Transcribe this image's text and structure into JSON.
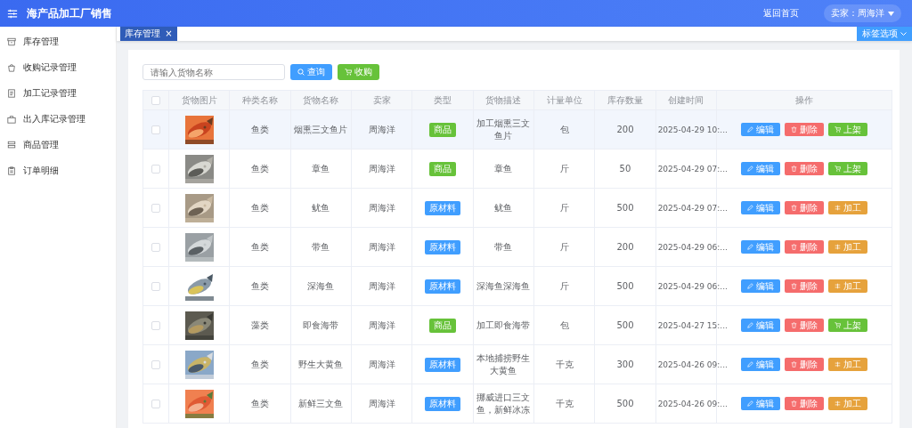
{
  "header": {
    "title": "海产品加工厂销售",
    "home_link": "返回首页",
    "user_menu": "卖家：周海洋"
  },
  "sidebar": {
    "items": [
      {
        "label": "库存管理"
      },
      {
        "label": "收购记录管理"
      },
      {
        "label": "加工记录管理"
      },
      {
        "label": "出入库记录管理"
      },
      {
        "label": "商品管理"
      },
      {
        "label": "订单明细"
      }
    ]
  },
  "tabs": [
    {
      "label": "库存管理",
      "close": "×",
      "selected": true
    }
  ],
  "tab_options": "标签选项",
  "search": {
    "placeholder": "请输入货物名称",
    "query_button": "查询",
    "buy_button": "收购"
  },
  "table": {
    "header_checked": false,
    "columns": [
      "货物图片",
      "种类名称",
      "货物名称",
      "卖家",
      "类型",
      "货物描述",
      "计量单位",
      "库存数量",
      "创建时间",
      "操作"
    ],
    "rows": [
      {
        "checked": false,
        "hovered": true,
        "category": "鱼类",
        "name": "烟熏三文鱼片",
        "seller": "周海洋",
        "type": {
          "label": "商品",
          "kind": "goods"
        },
        "description": "加工烟熏三文鱼片",
        "unit": "包",
        "stock": "200",
        "created": "2025-04-29 10:...",
        "actions": [
          {
            "label": "编辑",
            "kind": "edit"
          },
          {
            "label": "删除",
            "kind": "delete"
          },
          {
            "label": "上架",
            "kind": "shelve"
          }
        ]
      },
      {
        "checked": false,
        "hovered": false,
        "category": "鱼类",
        "name": "章鱼",
        "seller": "周海洋",
        "type": {
          "label": "商品",
          "kind": "goods"
        },
        "description": "章鱼",
        "unit": "斤",
        "stock": "50",
        "created": "2025-04-29 07:...",
        "actions": [
          {
            "label": "编辑",
            "kind": "edit"
          },
          {
            "label": "删除",
            "kind": "delete"
          },
          {
            "label": "上架",
            "kind": "shelve"
          }
        ]
      },
      {
        "checked": false,
        "hovered": false,
        "category": "鱼类",
        "name": "鱿鱼",
        "seller": "周海洋",
        "type": {
          "label": "原材料",
          "kind": "raw"
        },
        "description": "鱿鱼",
        "unit": "斤",
        "stock": "500",
        "created": "2025-04-29 07:...",
        "actions": [
          {
            "label": "编辑",
            "kind": "edit"
          },
          {
            "label": "删除",
            "kind": "delete"
          },
          {
            "label": "加工",
            "kind": "process"
          }
        ]
      },
      {
        "checked": false,
        "hovered": false,
        "category": "鱼类",
        "name": "带鱼",
        "seller": "周海洋",
        "type": {
          "label": "原材料",
          "kind": "raw"
        },
        "description": "带鱼",
        "unit": "斤",
        "stock": "200",
        "created": "2025-04-29 06:...",
        "actions": [
          {
            "label": "编辑",
            "kind": "edit"
          },
          {
            "label": "删除",
            "kind": "delete"
          },
          {
            "label": "加工",
            "kind": "process"
          }
        ]
      },
      {
        "checked": false,
        "hovered": false,
        "category": "鱼类",
        "name": "深海鱼",
        "seller": "周海洋",
        "type": {
          "label": "原材料",
          "kind": "raw"
        },
        "description": "深海鱼深海鱼",
        "unit": "斤",
        "stock": "500",
        "created": "2025-04-29 06:...",
        "actions": [
          {
            "label": "编辑",
            "kind": "edit"
          },
          {
            "label": "删除",
            "kind": "delete"
          },
          {
            "label": "加工",
            "kind": "process"
          }
        ]
      },
      {
        "checked": false,
        "hovered": false,
        "category": "藻类",
        "name": "即食海带",
        "seller": "周海洋",
        "type": {
          "label": "商品",
          "kind": "goods"
        },
        "description": "加工即食海带",
        "unit": "包",
        "stock": "500",
        "created": "2025-04-27 15:...",
        "actions": [
          {
            "label": "编辑",
            "kind": "edit"
          },
          {
            "label": "删除",
            "kind": "delete"
          },
          {
            "label": "上架",
            "kind": "shelve"
          }
        ]
      },
      {
        "checked": false,
        "hovered": false,
        "category": "鱼类",
        "name": "野生大黄鱼",
        "seller": "周海洋",
        "type": {
          "label": "原材料",
          "kind": "raw"
        },
        "description": "本地捕捞野生大黄鱼",
        "unit": "千克",
        "stock": "300",
        "created": "2025-04-26 09:...",
        "actions": [
          {
            "label": "编辑",
            "kind": "edit"
          },
          {
            "label": "删除",
            "kind": "delete"
          },
          {
            "label": "加工",
            "kind": "process"
          }
        ]
      },
      {
        "checked": false,
        "hovered": false,
        "category": "鱼类",
        "name": "新鲜三文鱼",
        "seller": "周海洋",
        "type": {
          "label": "原材料",
          "kind": "raw"
        },
        "description": "挪威进口三文鱼，新鲜冰冻",
        "unit": "千克",
        "stock": "500",
        "created": "2025-04-26 09:...",
        "actions": [
          {
            "label": "编辑",
            "kind": "edit"
          },
          {
            "label": "删除",
            "kind": "delete"
          },
          {
            "label": "加工",
            "kind": "process"
          }
        ]
      }
    ]
  }
}
